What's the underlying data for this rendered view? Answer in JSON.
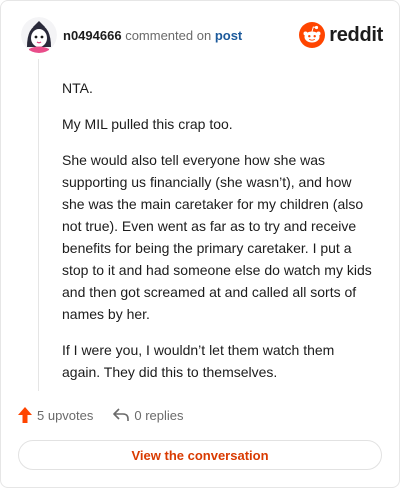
{
  "comment": {
    "username": "n0494666",
    "action_text": "commented on",
    "post_link": "post",
    "paragraphs": [
      "NTA.",
      "My MIL pulled this crap too.",
      "She would also tell everyone how she was supporting us financially (she wasn’t), and how she was the main caretaker for my children (also not true). Even went as far as to try and receive benefits for being the primary caretaker. I put a stop to it and had someone else do watch my kids and then got screamed at and called all sorts of names by her.",
      "If I were you, I wouldn’t let them watch them again. They did this to themselves."
    ]
  },
  "brand": {
    "name": "reddit",
    "color": "#ff4500"
  },
  "actions": {
    "upvotes": "5 upvotes",
    "replies": "0 replies"
  },
  "cta": {
    "label": "View the conversation"
  },
  "icons": {
    "upvote": "upvote-arrow-icon",
    "reply": "reply-arrow-icon",
    "logo": "reddit-alien-icon"
  }
}
